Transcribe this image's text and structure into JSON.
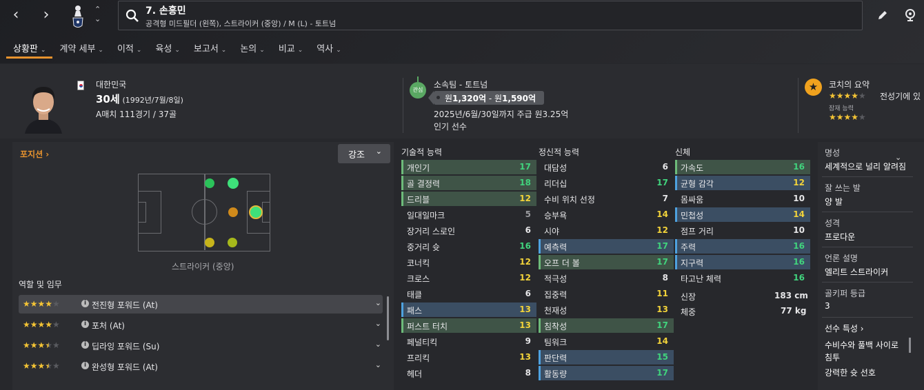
{
  "player": {
    "number_name": "7. 손흥민",
    "positions": "공격형 미드필더 (왼쪽), 스트라이커 (중앙) / M (L) - 토트넘",
    "nationality": "대한민국",
    "age": "30세",
    "dob": "(1992년/7월/8일)",
    "caps": "A매치 111경기 / 37골"
  },
  "tabs": [
    {
      "label": "상황판"
    },
    {
      "label": "계약 세부"
    },
    {
      "label": "이적"
    },
    {
      "label": "육성"
    },
    {
      "label": "보고서"
    },
    {
      "label": "논의"
    },
    {
      "label": "비교"
    },
    {
      "label": "역사"
    }
  ],
  "contract": {
    "watch_label": "관심",
    "club": "소속팀 - 토트넘",
    "value_prefix1": "원",
    "value_low": "1,320억",
    "value_sep": " - 원",
    "value_high": "1,590억",
    "expiry": "2025년/6월/30일까지 주급 원3.25억",
    "status": "인기 선수"
  },
  "coach": {
    "title": "코치의 요약",
    "summary": "전성기에 있",
    "potential_label": "잠재 능력",
    "ability_stars": 4,
    "potential_stars": 4
  },
  "position_panel": {
    "link": "포지션",
    "emphasis_button": "강조",
    "selected_position": "스트라이커 (중앙)"
  },
  "roles": {
    "title": "역할 및 임무",
    "items": [
      {
        "name": "전진형 포워드 (At)",
        "stars": 4
      },
      {
        "name": "포처 (At)",
        "stars": 4
      },
      {
        "name": "딥라잉 포워드 (Su)",
        "stars": 3.5
      },
      {
        "name": "완성형 포워드 (At)",
        "stars": 3.5
      }
    ]
  },
  "technical": {
    "title": "기술적 능력",
    "items": [
      {
        "name": "개인기",
        "value": "17",
        "hl": "green"
      },
      {
        "name": "골 결정력",
        "value": "18",
        "hl": "green"
      },
      {
        "name": "드리블",
        "value": "12",
        "hl": "green"
      },
      {
        "name": "일대일마크",
        "value": "5",
        "hl": ""
      },
      {
        "name": "장거리 스로인",
        "value": "6",
        "hl": ""
      },
      {
        "name": "중거리 슛",
        "value": "16",
        "hl": ""
      },
      {
        "name": "코너킥",
        "value": "12",
        "hl": ""
      },
      {
        "name": "크로스",
        "value": "12",
        "hl": ""
      },
      {
        "name": "태클",
        "value": "6",
        "hl": ""
      },
      {
        "name": "패스",
        "value": "13",
        "hl": "blue"
      },
      {
        "name": "퍼스트 터치",
        "value": "13",
        "hl": "green"
      },
      {
        "name": "페널티킥",
        "value": "9",
        "hl": ""
      },
      {
        "name": "프리킥",
        "value": "13",
        "hl": ""
      },
      {
        "name": "헤더",
        "value": "8",
        "hl": ""
      }
    ]
  },
  "mental": {
    "title": "정신적 능력",
    "items": [
      {
        "name": "대담성",
        "value": "6",
        "hl": ""
      },
      {
        "name": "리더십",
        "value": "17",
        "hl": ""
      },
      {
        "name": "수비 위치 선정",
        "value": "7",
        "hl": ""
      },
      {
        "name": "승부욕",
        "value": "14",
        "hl": ""
      },
      {
        "name": "시야",
        "value": "12",
        "hl": ""
      },
      {
        "name": "예측력",
        "value": "17",
        "hl": "blue"
      },
      {
        "name": "오프 더 볼",
        "value": "17",
        "hl": "green"
      },
      {
        "name": "적극성",
        "value": "8",
        "hl": ""
      },
      {
        "name": "집중력",
        "value": "11",
        "hl": ""
      },
      {
        "name": "천재성",
        "value": "13",
        "hl": ""
      },
      {
        "name": "침착성",
        "value": "17",
        "hl": "green"
      },
      {
        "name": "팀워크",
        "value": "14",
        "hl": ""
      },
      {
        "name": "판단력",
        "value": "15",
        "hl": "blue"
      },
      {
        "name": "활동량",
        "value": "17",
        "hl": "blue"
      }
    ]
  },
  "physical": {
    "title": "신체",
    "items": [
      {
        "name": "가속도",
        "value": "16",
        "hl": "green"
      },
      {
        "name": "균형 감각",
        "value": "12",
        "hl": "blue"
      },
      {
        "name": "몸싸움",
        "value": "10",
        "hl": ""
      },
      {
        "name": "민첩성",
        "value": "14",
        "hl": "blue"
      },
      {
        "name": "점프 거리",
        "value": "10",
        "hl": ""
      },
      {
        "name": "주력",
        "value": "16",
        "hl": "blue"
      },
      {
        "name": "지구력",
        "value": "16",
        "hl": "blue"
      },
      {
        "name": "타고난 체력",
        "value": "16",
        "hl": ""
      }
    ],
    "height_label": "신장",
    "height": "183 cm",
    "weight_label": "체중",
    "weight": "77 kg"
  },
  "info": {
    "reputation_label": "명성",
    "reputation": "세계적으로 널리 알려짐",
    "foot_label": "잘 쓰는 발",
    "foot": "양 발",
    "personality_label": "성격",
    "personality": "프로다운",
    "media_label": "언론 설명",
    "media": "엘리트 스트라이커",
    "gk_label": "골키퍼 등급",
    "gk": "3",
    "traits_label": "선수 특성",
    "trait1a": "수비수와 풀백 사이로",
    "trait1b": "침투",
    "trait2": "강력한 슛 선호"
  },
  "colors": {
    "accent": "#e7932e",
    "green": "#41d37d",
    "yellow": "#f2d33a",
    "highlight_green": "#3f5447",
    "highlight_blue": "#3b4e63"
  }
}
